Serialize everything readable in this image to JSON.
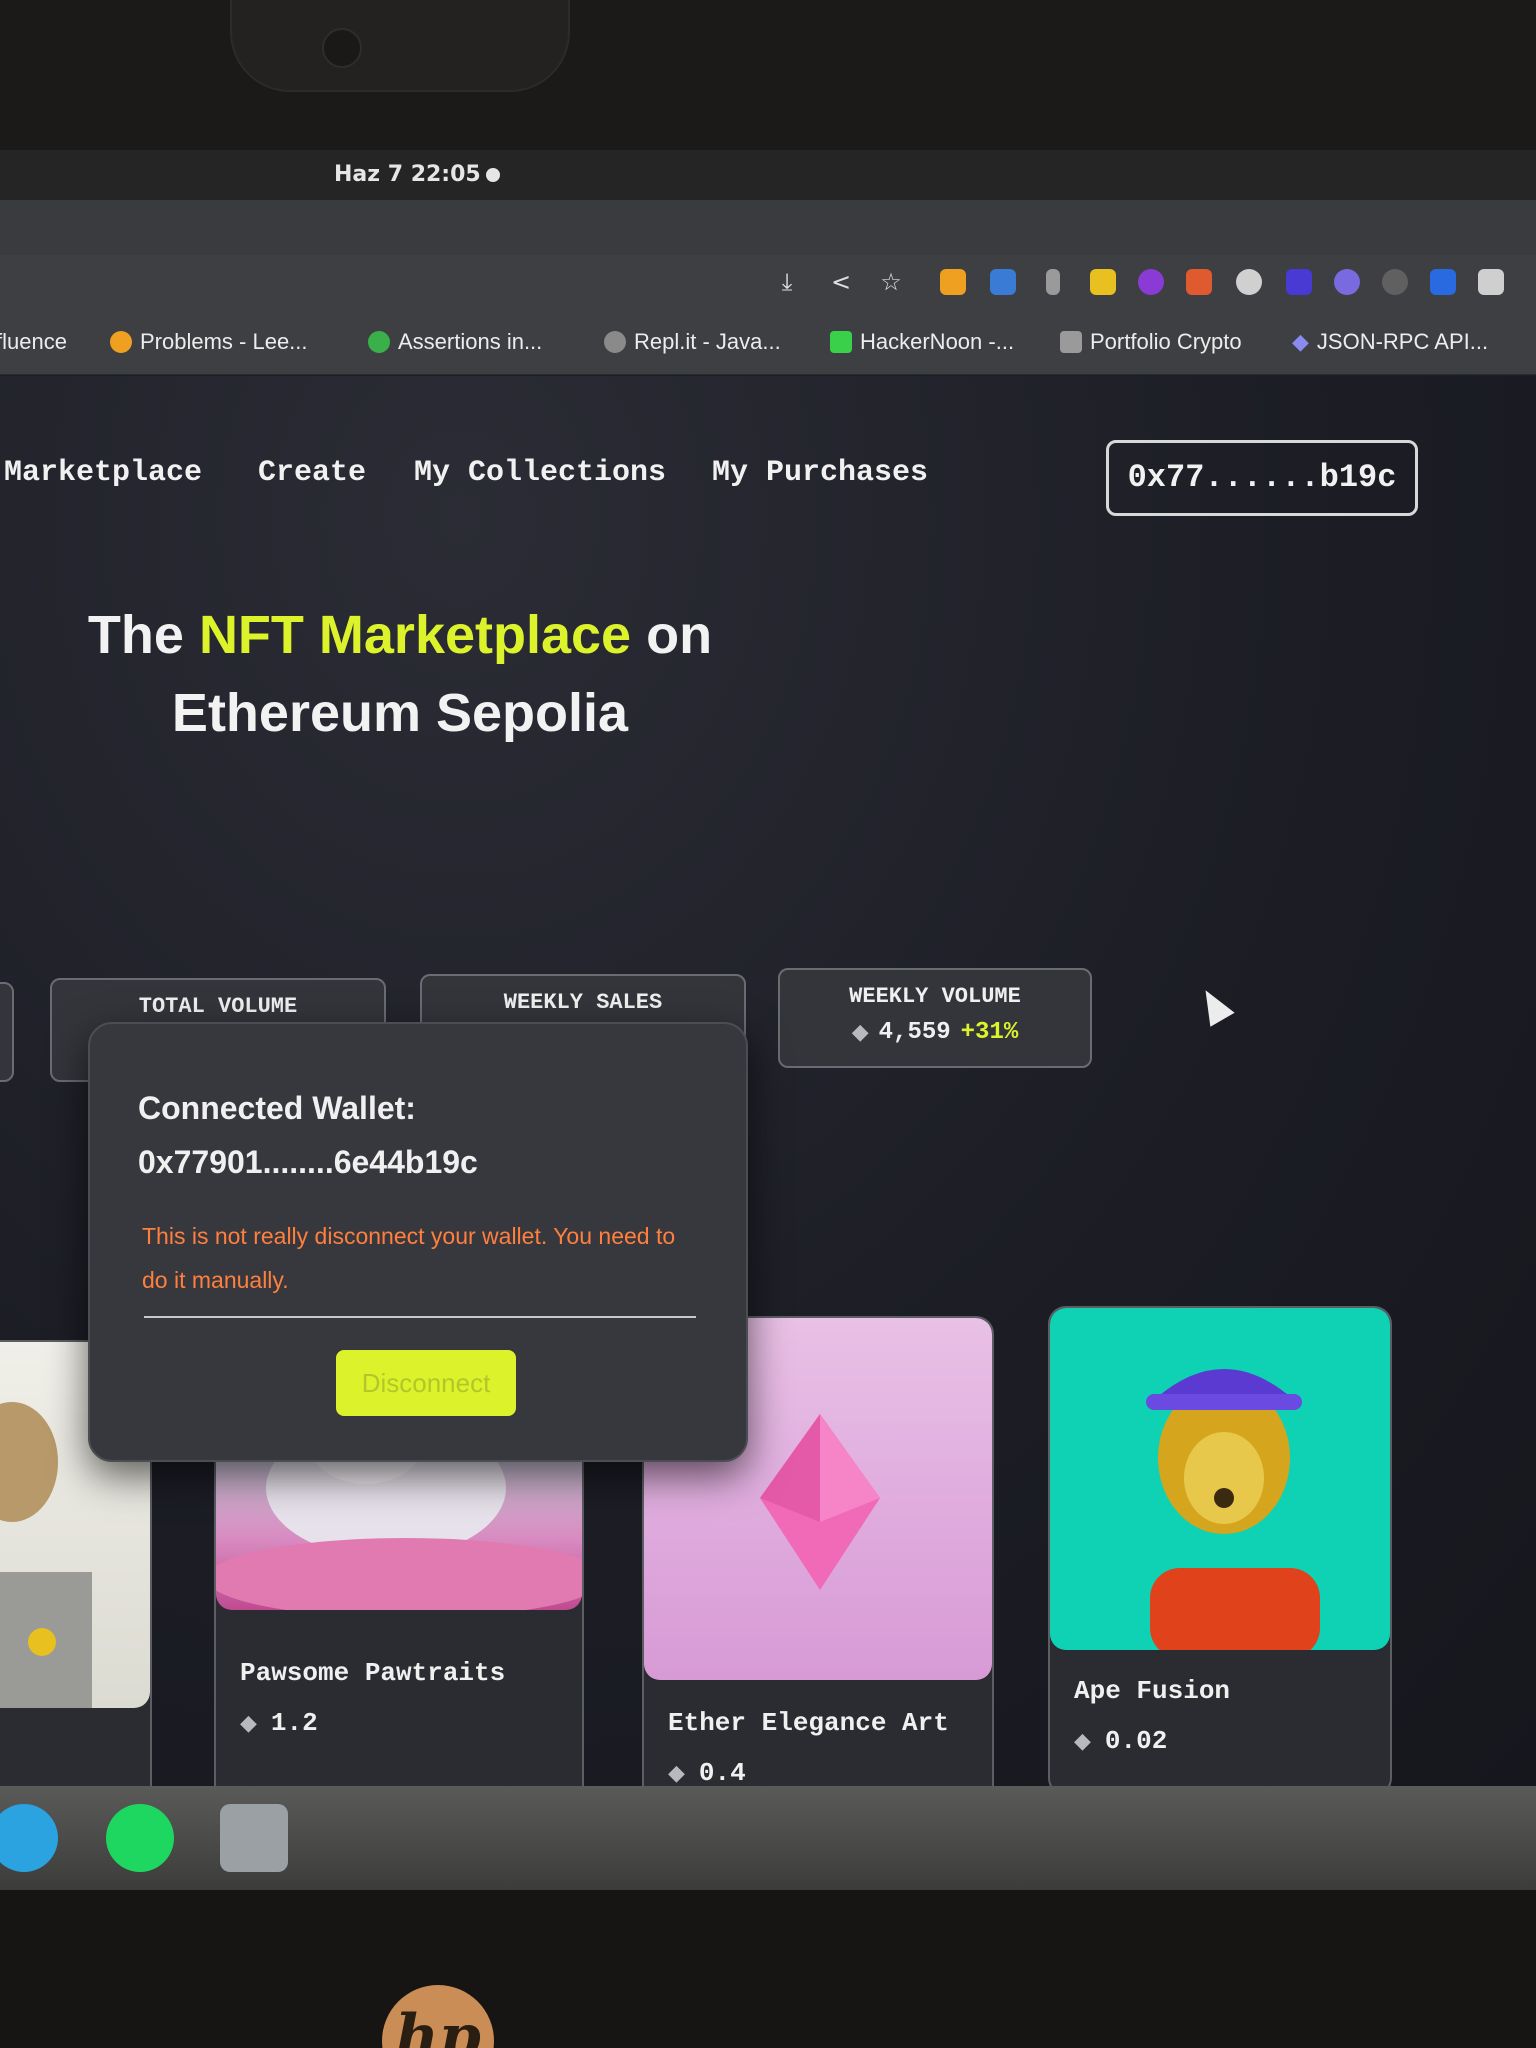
{
  "system": {
    "clock": "Haz 7  22:05"
  },
  "toolbar": {
    "icons": [
      "install-icon",
      "share-icon",
      "star-icon"
    ],
    "extensions": [
      "#f0a020",
      "#3a7bd5",
      "#9a9a9a",
      "#e8c020",
      "#8a3ad5",
      "#e05a30",
      "#d0d0d0",
      "#4a3ad5",
      "#7a6ae0",
      "#606060",
      "#2a6ae0",
      "#cfcfcf"
    ]
  },
  "bookmarks": [
    {
      "label": "fluence",
      "icon": "",
      "color": "#3e3f43"
    },
    {
      "label": "Problems - Lee...",
      "icon": "leetcode-icon",
      "color": "#f0a020"
    },
    {
      "label": "Assertions in...",
      "icon": "assertions-icon",
      "color": "#3ab04a"
    },
    {
      "label": "Repl.it - Java...",
      "icon": "replit-icon",
      "color": "#8a8a8a"
    },
    {
      "label": "HackerNoon -...",
      "icon": "hackernoon-icon",
      "color": "#3ad04a"
    },
    {
      "label": "Portfolio Crypto",
      "icon": "notion-icon",
      "color": "#9a9a9a"
    },
    {
      "label": "JSON-RPC API...",
      "icon": "ethereum-icon",
      "color": "#8a8aef"
    }
  ],
  "nav": {
    "links": [
      "Marketplace",
      "Create",
      "My Collections",
      "My Purchases"
    ],
    "wallet_button": "0x77......b19c"
  },
  "hero": {
    "prefix": "The",
    "accent": "NFT Marketplace",
    "suffix": "on",
    "line2": "Ethereum Sepolia"
  },
  "stats": [
    {
      "label": "TOTAL VOLUME"
    },
    {
      "label": "WEEKLY SALES"
    },
    {
      "label": "WEEKLY VOLUME",
      "value": "4,559",
      "change": "+31%"
    }
  ],
  "popup": {
    "title": "Connected Wallet:",
    "address": "0x77901........6e44b19c",
    "warning": "This is not really disconnect your wallet. You need to do it manually.",
    "button": "Disconnect"
  },
  "cards": [
    {
      "name": "",
      "price": ""
    },
    {
      "name": "Pawsome Pawtraits",
      "price": "1.2"
    },
    {
      "name": "Ether Elegance Art",
      "price": "0.4"
    },
    {
      "name": "Ape Fusion",
      "price": "0.02"
    }
  ],
  "dock": [
    "telegram-icon",
    "spotify-icon",
    "terminal-icon"
  ],
  "colors": {
    "accent": "#dcf22a",
    "warning": "#ff7f3f",
    "background": "#1d1e26"
  }
}
